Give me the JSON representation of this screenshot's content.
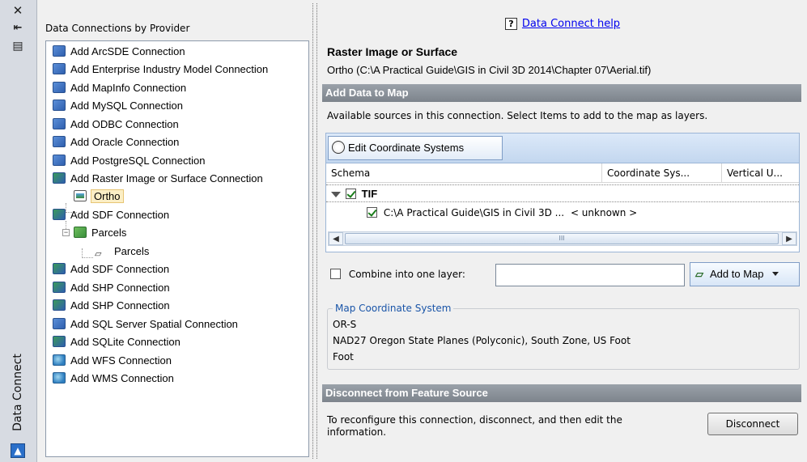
{
  "palette": {
    "title": "Data Connect",
    "close_glyph": "✕",
    "autohide_glyph": "⇤",
    "props_glyph": "▤",
    "bottom_glyph": "▲"
  },
  "left": {
    "title": "Data Connections by Provider",
    "items": [
      {
        "label": "Add ArcSDE Connection",
        "icon": "db-connection-icon"
      },
      {
        "label": "Add Enterprise Industry Model Connection",
        "icon": "db-connection-icon"
      },
      {
        "label": "Add MapInfo Connection",
        "icon": "db-connection-icon"
      },
      {
        "label": "Add MySQL Connection",
        "icon": "db-connection-icon"
      },
      {
        "label": "Add ODBC Connection",
        "icon": "db-connection-icon"
      },
      {
        "label": "Add Oracle Connection",
        "icon": "db-connection-icon"
      },
      {
        "label": "Add PostgreSQL Connection",
        "icon": "db-connection-icon"
      },
      {
        "label": "Add Raster Image or Surface Connection",
        "icon": "raster-connection-icon"
      },
      {
        "label": "Ortho",
        "icon": "raster-image-icon",
        "selected": true
      },
      {
        "label": "Add SDF Connection",
        "icon": "raster-connection-icon"
      },
      {
        "label": "Parcels",
        "icon": "feature-source-icon"
      },
      {
        "label": "Parcels",
        "icon": "polygon-layer-icon"
      },
      {
        "label": "Add SDF Connection",
        "icon": "raster-connection-icon"
      },
      {
        "label": "Add SHP Connection",
        "icon": "raster-connection-icon"
      },
      {
        "label": "Add SHP Connection",
        "icon": "raster-connection-icon"
      },
      {
        "label": "Add SQL Server Spatial Connection",
        "icon": "db-connection-icon"
      },
      {
        "label": "Add SQLite Connection",
        "icon": "raster-connection-icon"
      },
      {
        "label": "Add WFS Connection",
        "icon": "globe-connection-icon"
      },
      {
        "label": "Add WMS Connection",
        "icon": "globe-connection-icon"
      }
    ]
  },
  "help": {
    "q": "?",
    "link": "Data Connect help"
  },
  "source": {
    "title": "Raster Image or Surface",
    "path": "Ortho (C:\\A Practical Guide\\GIS in Civil 3D 2014\\Chapter 07\\Aerial.tif)"
  },
  "add_data": {
    "header": "Add Data to Map",
    "available": "Available sources in this connection.  Select Items to add to the map as layers.",
    "edit_cs_label": "Edit Coordinate Systems",
    "columns": [
      "Schema",
      "Coordinate Sys...",
      "Vertical U..."
    ],
    "group": {
      "label": "TIF",
      "checked": true
    },
    "row": {
      "label": "C:\\A Practical Guide\\GIS in Civil 3D ...",
      "cs": "< unknown >",
      "checked": true
    },
    "scroll_left": "◀",
    "scroll_right": "▶",
    "scroll_grip": "III",
    "combine_label": "Combine into one layer:",
    "combine_value": "",
    "add_to_map_label": "Add to Map"
  },
  "map_cs": {
    "legend": "Map Coordinate System",
    "code": "OR-S",
    "description": "NAD27 Oregon State Planes (Polyconic), South Zone, US Foot",
    "unit": "Foot"
  },
  "disconnect": {
    "header": "Disconnect from Feature Source",
    "text": "To reconfigure this connection, disconnect, and then edit the information.",
    "button": "Disconnect"
  }
}
